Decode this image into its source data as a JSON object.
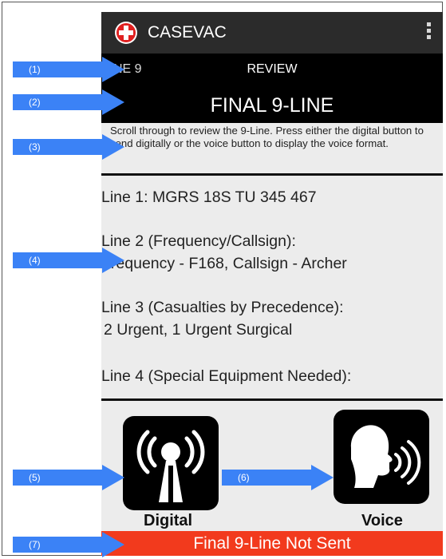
{
  "app": {
    "title": "CASEVAC"
  },
  "nav": {
    "left": "NE 9",
    "center": "REVIEW"
  },
  "screen": {
    "title": "FINAL 9-LINE"
  },
  "instructions": "Scroll through to review the 9-Line. Press either the digital button to send digitally or the voice button to display the voice format.",
  "lines": [
    {
      "label": "Line 1: MGRS 18S TU 345 467",
      "value": ""
    },
    {
      "label": "Line 2 (Frequency/Callsign):",
      "value": "Frequency - F168, Callsign - Archer"
    },
    {
      "label": "Line 3 (Casualties by Precedence):",
      "value": "2 Urgent, 1 Urgent Surgical"
    },
    {
      "label": "Line 4 (Special Equipment Needed):",
      "value": ""
    }
  ],
  "buttons": {
    "digital": "Digital",
    "voice": "Voice"
  },
  "status": "Final 9-Line Not Sent",
  "callouts": [
    "(1)",
    "(2)",
    "(3)",
    "(4)",
    "(5)",
    "(6)",
    "(7)"
  ],
  "colors": {
    "accent_red": "#f23a1d",
    "callout_blue": "#3b82f6",
    "bar_black": "#000000"
  },
  "icons": [
    "medical-cross-icon",
    "overflow-menu-icon",
    "radio-antenna-icon",
    "voice-speaking-icon"
  ]
}
